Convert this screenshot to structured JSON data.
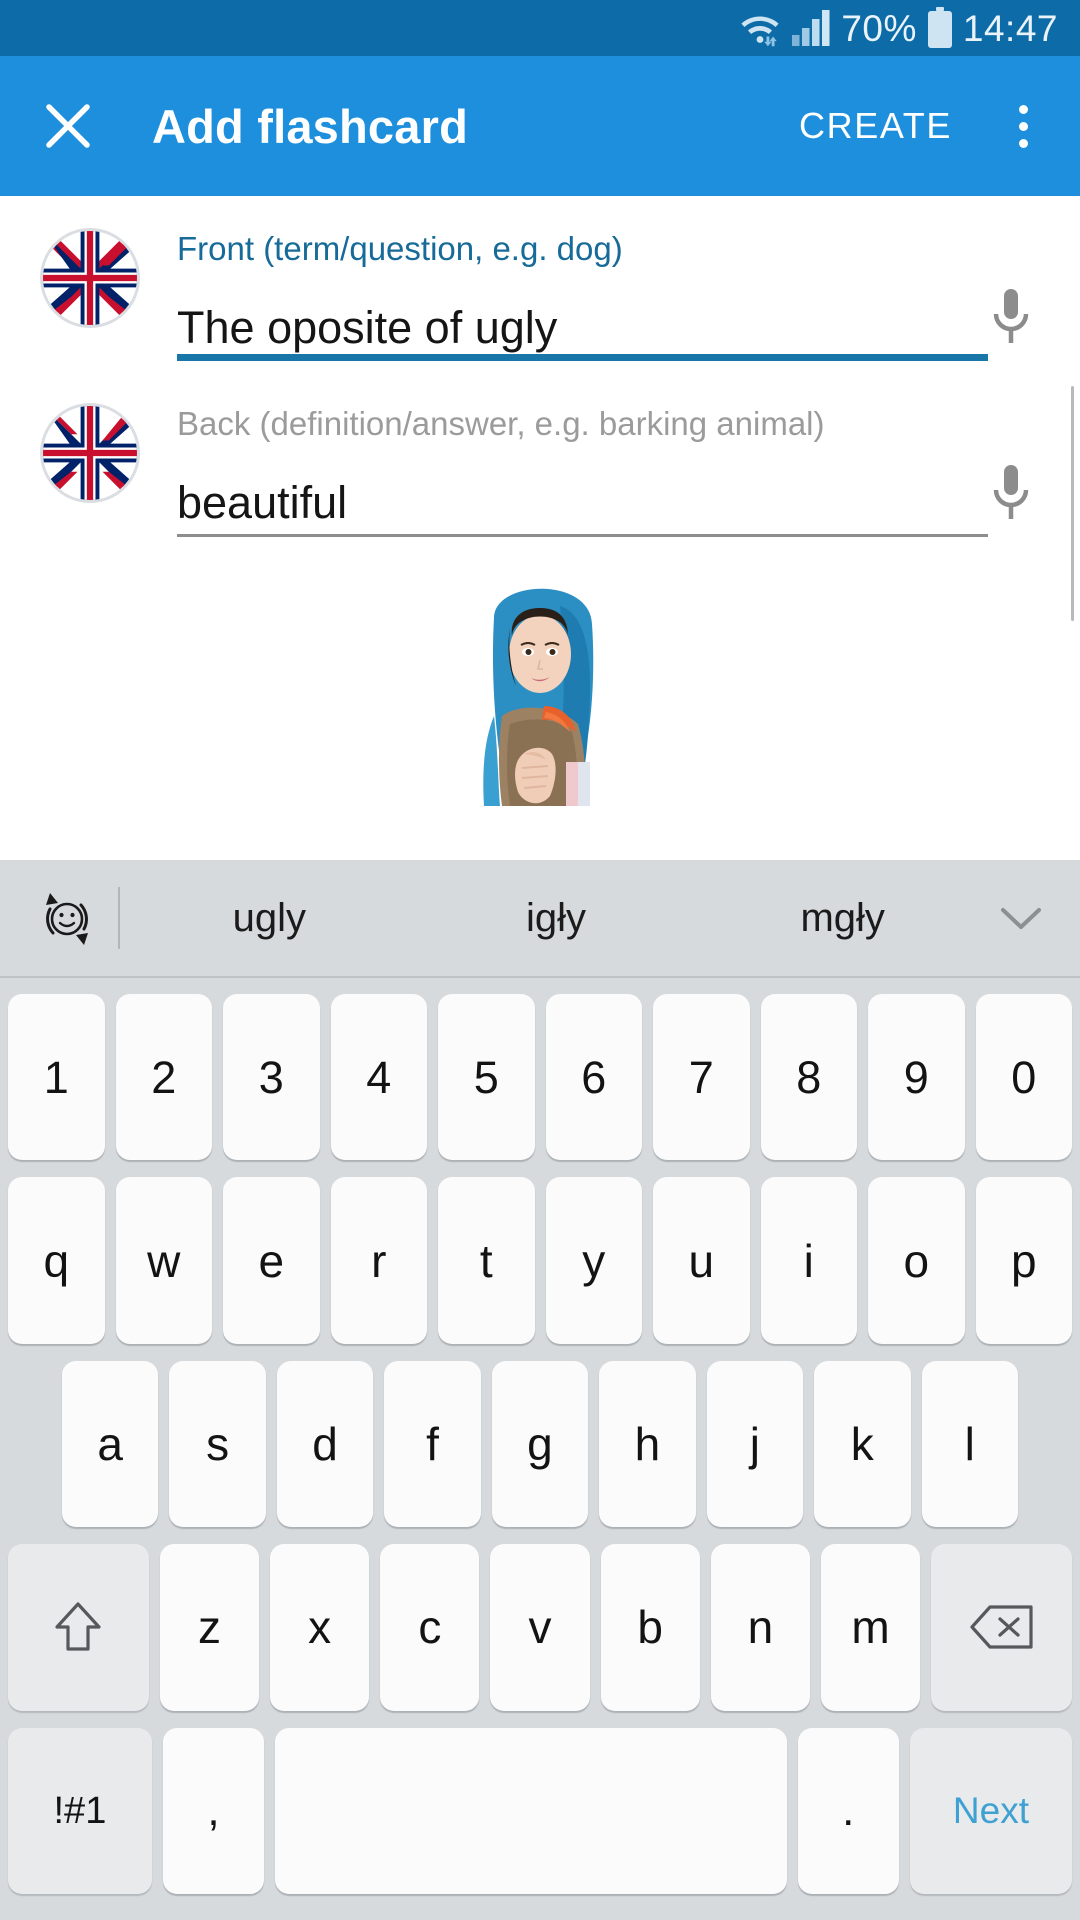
{
  "statusbar": {
    "wifi_icon": "wifi-icon",
    "signal_icon": "cellular-signal-icon",
    "battery_percent": "70%",
    "battery_icon": "battery-icon",
    "time": "14:47"
  },
  "appbar": {
    "close_icon": "close-icon",
    "title": "Add flashcard",
    "create_label": "CREATE",
    "overflow_icon": "overflow-menu-icon",
    "background_color": "#1E8FDD"
  },
  "form": {
    "front": {
      "label": "Front (term/question, e.g. dog)",
      "value_parts": [
        {
          "text": "The",
          "spell": "gray"
        },
        {
          "text": " ",
          "spell": "none"
        },
        {
          "text": "oposite",
          "spell": "gray"
        },
        {
          "text": " of ",
          "spell": "none"
        },
        {
          "text": "ugly",
          "spell": "dark"
        }
      ],
      "value": "The oposite of ugly",
      "flag_icon": "uk-flag-icon",
      "mic_icon": "microphone-icon",
      "focused": true,
      "underline_color": "#1877A8"
    },
    "back": {
      "label": "Back (definition/answer, e.g. barking animal)",
      "value": "beautiful",
      "flag_icon": "uk-flag-icon",
      "mic_icon": "microphone-icon",
      "focused": false,
      "underline_color": "#8d8d8d"
    },
    "card_image_alt": "woman-in-headscarf-photo",
    "scrollbar": "vertical-scrollbar"
  },
  "keyboard": {
    "emoji_icon": "emoji-rotate-icon",
    "suggestions": [
      "ugly",
      "igły",
      "mgły"
    ],
    "expand_icon": "chevron-down-icon",
    "rows": {
      "numbers": [
        "1",
        "2",
        "3",
        "4",
        "5",
        "6",
        "7",
        "8",
        "9",
        "0"
      ],
      "top": [
        "q",
        "w",
        "e",
        "r",
        "t",
        "y",
        "u",
        "i",
        "o",
        "p"
      ],
      "home": [
        "a",
        "s",
        "d",
        "f",
        "g",
        "h",
        "j",
        "k",
        "l"
      ],
      "bottom": [
        "z",
        "x",
        "c",
        "v",
        "b",
        "n",
        "m"
      ]
    },
    "shift_icon": "shift-arrow-icon",
    "backspace_icon": "backspace-icon",
    "symbols_label": "!#1",
    "comma_label": ",",
    "space_label": "",
    "period_label": ".",
    "next_label": "Next",
    "background_color": "#d6dadd",
    "key_color": "#fbfbfb",
    "next_text_color": "#3FA0D2"
  }
}
